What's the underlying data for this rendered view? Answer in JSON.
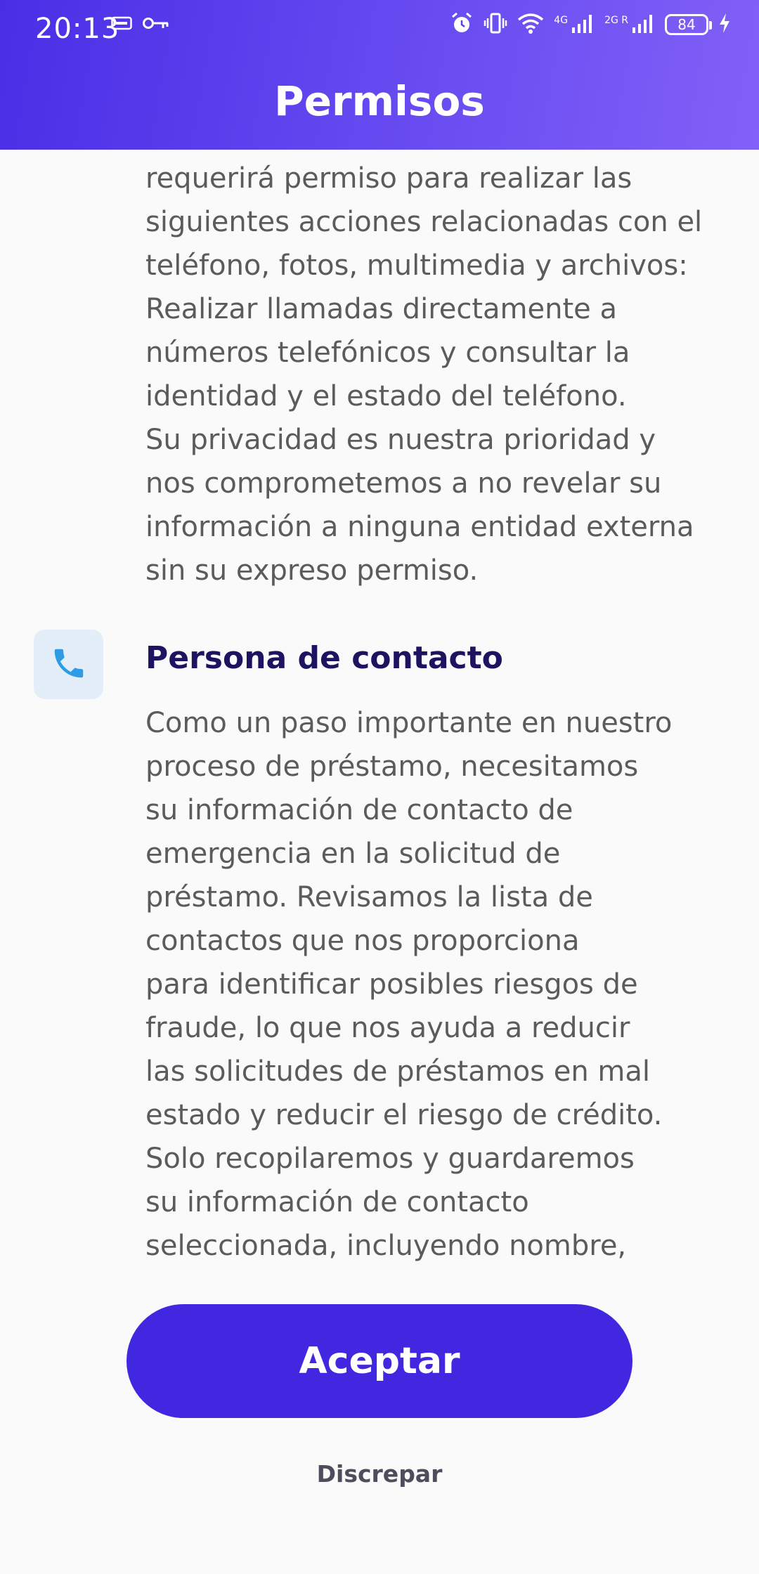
{
  "status_bar": {
    "time": "20:13",
    "network_4g_label": "4G",
    "network_2g_label": "2G R",
    "battery_level": "84"
  },
  "header": {
    "title": "Permisos"
  },
  "permissions": {
    "intro_text": "requerirá permiso para realizar las\nsiguientes acciones relacionadas con el\nteléfono, fotos, multimedia y archivos:\nRealizar llamadas directamente a\nnúmeros telefónicos y consultar la\nidentidad y el estado del teléfono.\nSu privacidad es nuestra prioridad y\nnos comprometemos a no revelar su\ninformación a ninguna entidad externa\nsin su expreso permiso.",
    "contact_section": {
      "icon": "phone-icon",
      "title": "Persona de contacto",
      "text": "Como un paso importante en nuestro\nproceso de préstamo, necesitamos\nsu información de contacto de\nemergencia en la solicitud de\npréstamo. Revisamos la lista de\ncontactos que nos proporciona\npara identificar posibles riesgos de\nfraude, lo que nos ayuda a reducir\nlas solicitudes de préstamos en mal\nestado y reducir el riesgo de crédito.\nSolo recopilaremos y guardaremos\nsu información de contacto\nseleccionada, incluyendo nombre,"
    }
  },
  "actions": {
    "accept_label": "Aceptar",
    "disagree_label": "Discrepar"
  },
  "colors": {
    "header_gradient_start": "#4a2ee6",
    "header_gradient_end": "#8360f7",
    "accent": "#4227e0",
    "section_title": "#1c1460",
    "body_text": "#5b5b5b",
    "icon_blue": "#2e9be6"
  }
}
